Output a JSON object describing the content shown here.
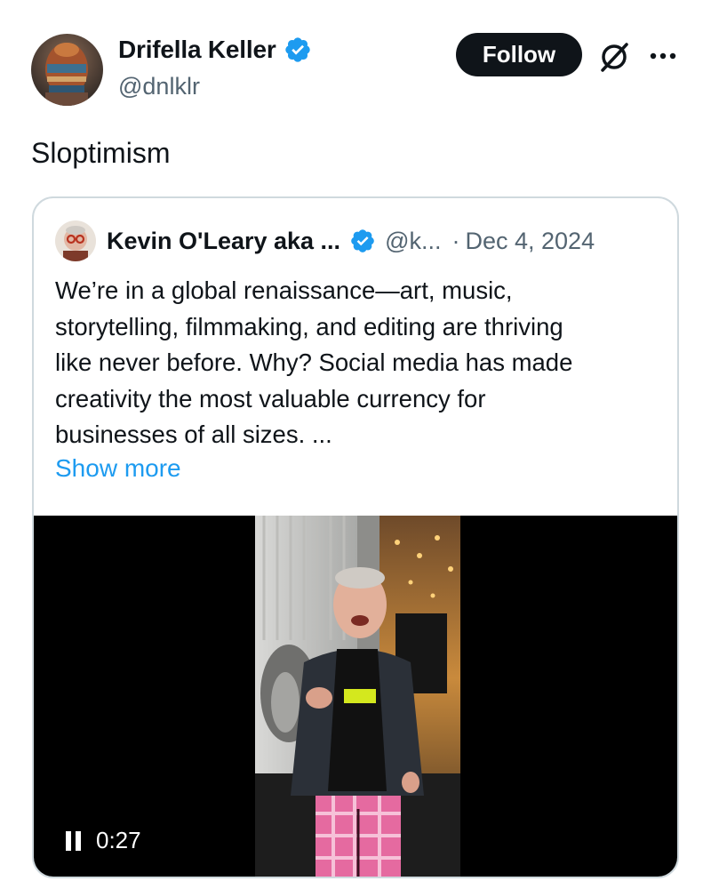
{
  "post": {
    "author": {
      "name": "Drifella Keller",
      "handle": "@dnlklr",
      "verified": true
    },
    "follow_label": "Follow",
    "text": "Sloptimism",
    "icons": {
      "grok": "grok-icon",
      "more": "more-icon"
    }
  },
  "quote": {
    "author": {
      "name": "Kevin O'Leary aka ...",
      "handle": "@k...",
      "verified": true
    },
    "dot": "·",
    "date": "Dec 4, 2024",
    "lines": [
      "We’re in a global renaissance—art, music,",
      "storytelling, filmmaking, and editing are thriving",
      "like never before. Why? Social media has made",
      "creativity the most valuable currency for",
      "businesses of all sizes. ..."
    ],
    "show_more": "Show more",
    "video": {
      "time": "0:27",
      "state": "playing"
    }
  },
  "colors": {
    "text": "#0f1419",
    "secondary": "#536471",
    "link": "#1d9bf0",
    "verified": "#1d9bf0",
    "border": "#cfd9de"
  }
}
